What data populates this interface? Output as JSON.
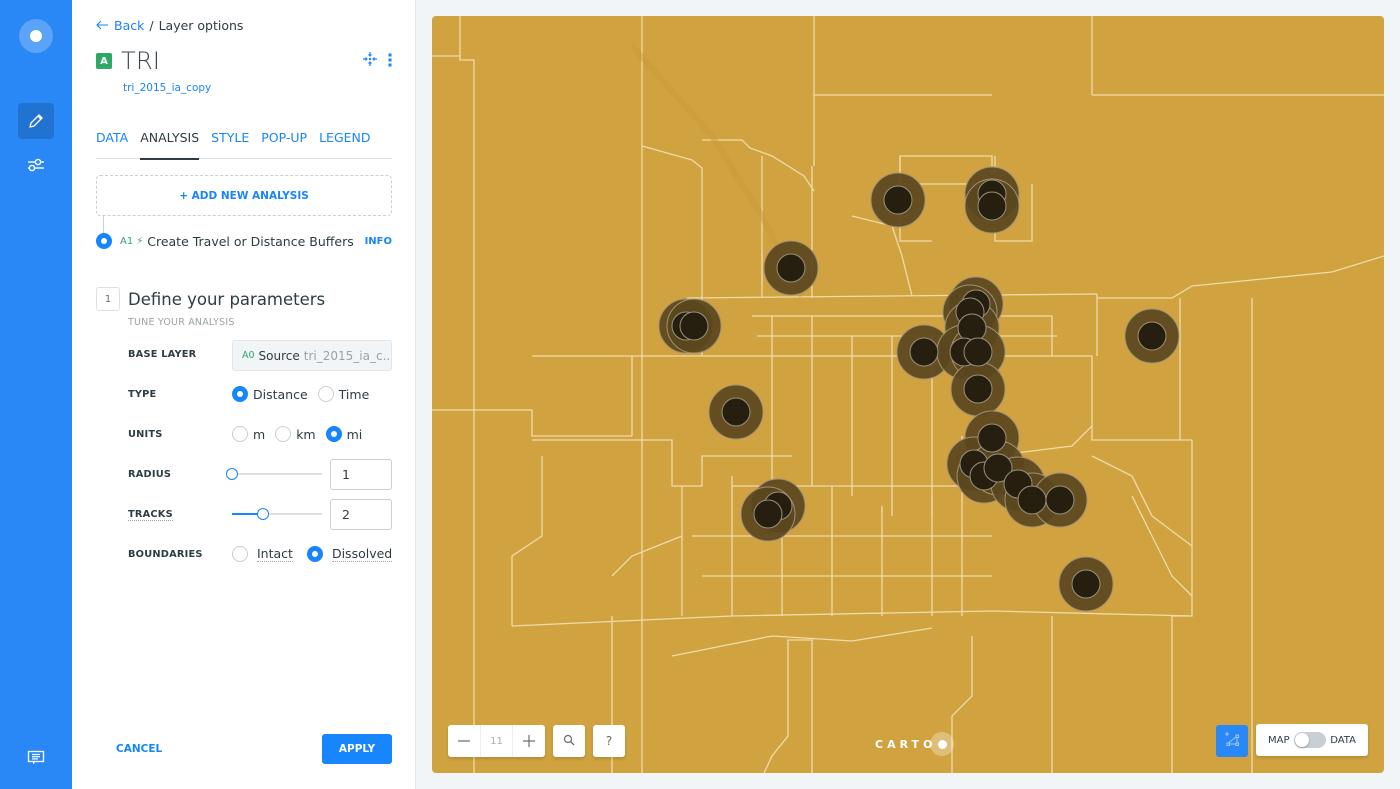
{
  "rail": {
    "items": [
      {
        "name": "edit",
        "icon": "pencil-icon",
        "active": true
      },
      {
        "name": "settings",
        "icon": "sliders-icon",
        "active": false
      }
    ],
    "bottom_icon": "chat-icon"
  },
  "header": {
    "back_label": "Back",
    "crumb_separator": "/",
    "crumb_current": "Layer options",
    "layer_letter": "A",
    "layer_title": "TRI",
    "layer_source": "tri_2015_ia_copy"
  },
  "tabs": [
    {
      "label": "DATA",
      "active": false
    },
    {
      "label": "ANALYSIS",
      "active": true
    },
    {
      "label": "STYLE",
      "active": false
    },
    {
      "label": "POP-UP",
      "active": false
    },
    {
      "label": "LEGEND",
      "active": false
    }
  ],
  "add_analysis_label": "+ ADD NEW ANALYSIS",
  "analysis": {
    "id": "A1",
    "title": "Create Travel or Distance Buffers",
    "info_label": "INFO"
  },
  "step": {
    "number": "1",
    "title": "Define your parameters",
    "subtitle": "TUNE YOUR ANALYSIS"
  },
  "fields": {
    "base_layer": {
      "label": "BASE LAYER",
      "id": "A0",
      "source": "Source",
      "table": "tri_2015_ia_c..."
    },
    "type": {
      "label": "TYPE",
      "options": [
        "Distance",
        "Time"
      ],
      "selected": "Distance"
    },
    "units": {
      "label": "UNITS",
      "options": [
        "m",
        "km",
        "mi"
      ],
      "selected": "mi"
    },
    "radius": {
      "label": "RADIUS",
      "value": "1",
      "slider_fraction": 0.0
    },
    "tracks": {
      "label": "TRACKS",
      "value": "2",
      "slider_fraction": 0.34
    },
    "boundaries": {
      "label": "BOUNDARIES",
      "options": [
        "Intact",
        "Dissolved"
      ],
      "selected": "Dissolved"
    }
  },
  "footer": {
    "cancel_label": "CANCEL",
    "apply_label": "APPLY"
  },
  "map": {
    "background_color": "#d0a340",
    "zoom_level": "11",
    "zoom_out_label": "−",
    "zoom_in_label": "+",
    "help_label": "?",
    "attribution": "CARTO",
    "toggle_left": "MAP",
    "toggle_right": "DATA"
  }
}
